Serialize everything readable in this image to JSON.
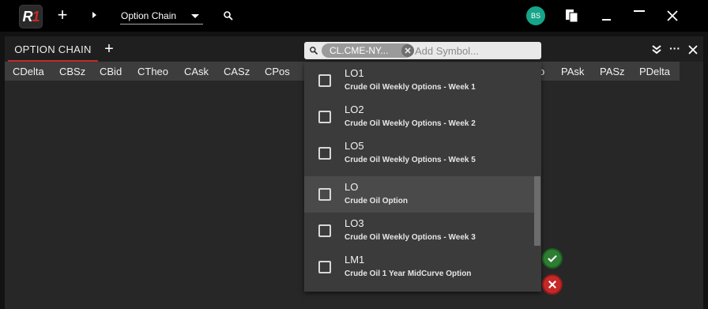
{
  "app": {
    "logo_text": "R1",
    "initials": "BS"
  },
  "topbar": {
    "layout_selector_value": "Option Chain"
  },
  "panel": {
    "tab_title": "OPTION CHAIN",
    "symbol_chip": "CL.CME-NY...",
    "symbol_placeholder": "Add Symbol..."
  },
  "columns": [
    "CDelta",
    "CBSz",
    "CBid",
    "CTheo",
    "CAsk",
    "CASz",
    "CPos",
    "o",
    "PAsk",
    "PASz",
    "PDelta"
  ],
  "dropdown": {
    "options": [
      {
        "code": "LO1",
        "description": "Crude Oil Weekly Options - Week 1",
        "highlighted": false
      },
      {
        "code": "LO2",
        "description": "Crude Oil Weekly Options - Week 2",
        "highlighted": false
      },
      {
        "code": "LO5",
        "description": "Crude Oil Weekly Options - Week 5",
        "highlighted": false
      },
      {
        "code": "LO",
        "description": "Crude Oil Option",
        "highlighted": true
      },
      {
        "code": "LO3",
        "description": "Crude Oil Weekly Options - Week 3",
        "highlighted": false
      },
      {
        "code": "LM1",
        "description": "Crude Oil 1 Year MidCurve Option",
        "highlighted": false
      }
    ]
  },
  "colors": {
    "accent": "#c62828",
    "avatar": "#17a589",
    "confirm": "#2e7d32",
    "cancel": "#c62828"
  }
}
